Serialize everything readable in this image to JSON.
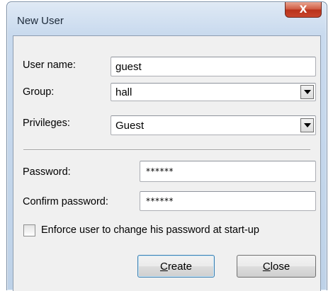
{
  "window": {
    "title": "New User",
    "close_glyph": "X"
  },
  "form": {
    "username": {
      "label": "User name:",
      "value": "guest"
    },
    "group": {
      "label": "Group:",
      "value": "hall"
    },
    "privileges": {
      "label": "Privileges:",
      "value": "Guest"
    },
    "password": {
      "label": "Password:",
      "value": "******"
    },
    "confirm_password": {
      "label": "Confirm password:",
      "value": "******"
    },
    "enforce_change": {
      "label": "Enforce user to change his password at start-up",
      "checked": false
    }
  },
  "buttons": {
    "create": {
      "accel": "C",
      "rest": "reate"
    },
    "close": {
      "accel": "C",
      "rest": "lose"
    }
  },
  "icons": {
    "dropdown": "chevron-down-icon",
    "close": "close-icon"
  }
}
